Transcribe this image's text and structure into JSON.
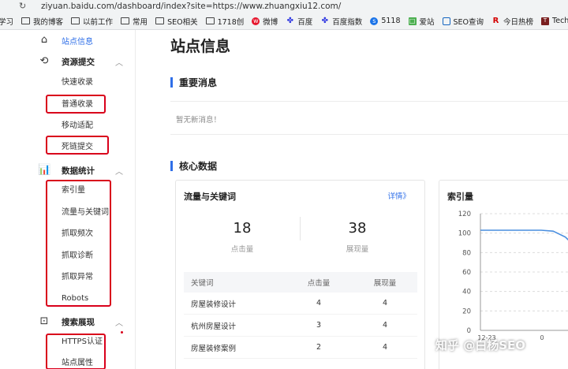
{
  "browser": {
    "url": "ziyuan.baidu.com/dashboard/index?site=https://www.zhuangxiu12.com/",
    "bookmarks": [
      {
        "label": "学习",
        "icon": "none"
      },
      {
        "label": "我的博客",
        "icon": "folder-icon"
      },
      {
        "label": "以前工作",
        "icon": "folder-icon"
      },
      {
        "label": "常用",
        "icon": "folder-icon"
      },
      {
        "label": "SEO相关",
        "icon": "folder-icon"
      },
      {
        "label": "1718创",
        "icon": "folder-icon"
      },
      {
        "label": "微博",
        "icon": "weibo-icon"
      },
      {
        "label": "百度",
        "icon": "baidu-paw-icon"
      },
      {
        "label": "百度指数",
        "icon": "baidu-paw-icon"
      },
      {
        "label": "5118",
        "icon": "5118-icon"
      },
      {
        "label": "爱站",
        "icon": "aizhan-icon"
      },
      {
        "label": "SEO查询",
        "icon": "seo-query-icon"
      },
      {
        "label": "今日热榜",
        "icon": "r-icon"
      },
      {
        "label": "TechWeb",
        "icon": "techweb-icon"
      }
    ]
  },
  "sidebar": {
    "site_info": "站点信息",
    "groups": [
      {
        "label": "资源提交",
        "items": [
          "快速收录",
          "普通收录",
          "移动适配",
          "死链提交"
        ]
      },
      {
        "label": "数据统计",
        "items": [
          "索引量",
          "流量与关键词",
          "抓取频次",
          "抓取诊断",
          "抓取异常",
          "Robots"
        ]
      },
      {
        "label": "搜索展现",
        "items": [
          "HTTPS认证",
          "站点属性"
        ]
      }
    ]
  },
  "main": {
    "title": "站点信息",
    "important_title": "重要消息",
    "no_news": "暂无新消息！",
    "core_title": "核心数据",
    "traffic_card": {
      "title": "流量与关键词",
      "detail_link": "详情》",
      "clicks": "18",
      "clicks_label": "点击量",
      "impressions": "38",
      "impressions_label": "展现量",
      "columns": [
        "关键词",
        "点击量",
        "展现量"
      ],
      "rows": [
        [
          "房屋装修设计",
          "4",
          "4"
        ],
        [
          "杭州房屋设计",
          "3",
          "4"
        ],
        [
          "房屋装修案例",
          "2",
          "4"
        ]
      ]
    },
    "index_card": {
      "title": "索引量"
    }
  },
  "chart_data": {
    "type": "line",
    "title": "索引量",
    "ylim": [
      0,
      120
    ],
    "yticks": [
      0,
      20,
      40,
      60,
      80,
      100,
      120
    ],
    "xtick_labels": [
      "12-23",
      "0"
    ],
    "series": [
      {
        "values": [
          103,
          103,
          103,
          103,
          103,
          103,
          102,
          96,
          84
        ]
      }
    ],
    "color": "#4a8fdf",
    "grid": "dashed horizontal"
  },
  "watermark": "知乎 @白杨SEO"
}
